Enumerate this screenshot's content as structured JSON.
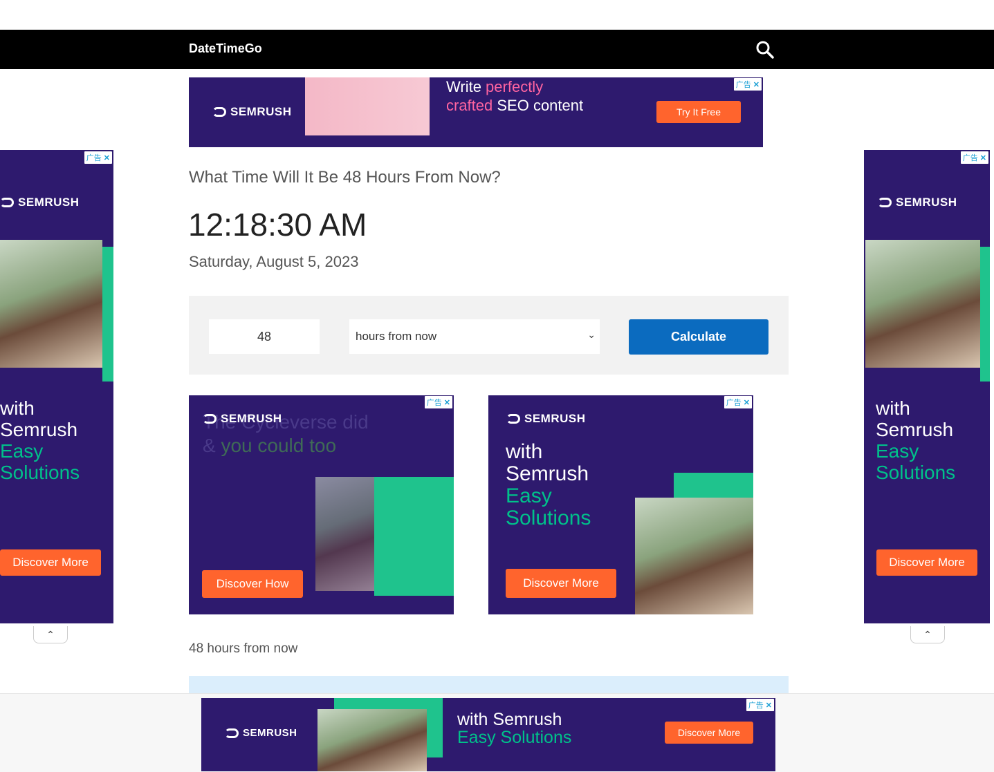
{
  "header": {
    "brand": "DateTimeGo",
    "search_icon": "search-icon"
  },
  "ads": {
    "brand": "SEMRUSH",
    "adchoice": "广告",
    "top": {
      "line1a": "Write ",
      "line1b": "perfectly",
      "line2a": "crafted",
      "line2b": " SEO content",
      "cta": "Try It Free"
    },
    "left_square": {
      "line1": "The Cycleverse did",
      "line2a": "& ",
      "line2b": "you could too",
      "cta": "Discover How"
    },
    "right_square": {
      "line1": "with",
      "line2": "Semrush",
      "line3": "Easy",
      "line4": "Solutions",
      "cta": "Discover More"
    },
    "sky_left": {
      "line1": "with",
      "line2": "Semrush",
      "line3": "Easy",
      "line4": "Solutions",
      "cta": "Discover More"
    },
    "sky_right": {
      "line1": "with",
      "line2": "Semrush",
      "line3": "Easy",
      "line4": "Solutions",
      "cta": "Discover More"
    },
    "bottom": {
      "line1": "with Semrush",
      "line2": "Easy Solutions",
      "cta": "Discover More"
    }
  },
  "main": {
    "title": "What Time Will It Be 48 Hours From Now?",
    "time": "12:18:30 AM",
    "date": "Saturday, August 5, 2023",
    "form": {
      "amount": "48",
      "unit": "hours from now",
      "button": "Calculate"
    },
    "result_label": "48 hours from now"
  },
  "colors": {
    "ad_bg": "#2e1a6e",
    "accent_green": "#00c18a",
    "cta_orange": "#ff642d",
    "button_blue": "#0b6bbf"
  }
}
